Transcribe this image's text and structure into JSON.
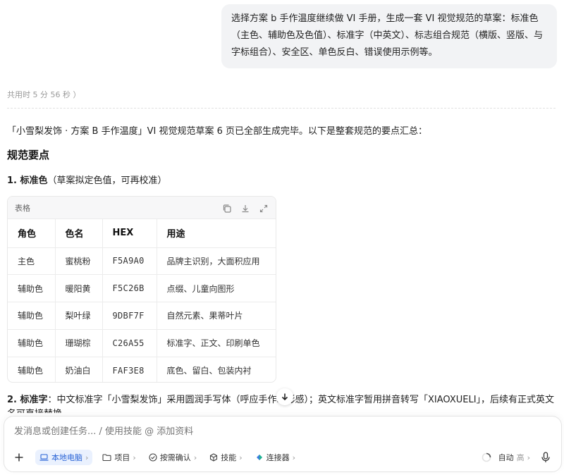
{
  "user_message": {
    "text": "选择方案 b 手作温度继续做 VI 手册，生成一套 VI 视觉规范的草案：标准色（主色、辅助色及色值）、标准字（中英文）、标志组合规范（横版、竖版、与字标组合）、安全区、单色反白、错误使用示例等。"
  },
  "elapsed": "共用时 5 分 56 秒 ）",
  "reply": {
    "intro": "「小雪梨发饰 · 方案 B 手作温度」VI 视觉规范草案 6 页已全部生成完毕。以下是整套规范的要点汇总：",
    "section_title": "规范要点",
    "color_heading_bold": "1. 标准色",
    "color_heading_note": "（草案拟定色值，可再校准）",
    "table": {
      "label": "表格",
      "headers": [
        "角色",
        "色名",
        "HEX",
        "用途"
      ],
      "rows": [
        [
          "主色",
          "蜜桃粉",
          "F5A9A0",
          "品牌主识别，大面积应用"
        ],
        [
          "辅助色",
          "暖阳黄",
          "F5C26B",
          "点缀、儿童向图形"
        ],
        [
          "辅助色",
          "梨叶绿",
          "9DBF7F",
          "自然元素、果蒂叶片"
        ],
        [
          "辅助色",
          "珊瑚棕",
          "C26A55",
          "标准字、正文、印刷单色"
        ],
        [
          "辅助色",
          "奶油白",
          "FAF3E8",
          "底色、留白、包装内衬"
        ]
      ]
    },
    "font_heading_bold": "2. 标准字",
    "font_text": "：中文标准字「小雪梨发饰」采用圆润手写体（呼应手作水彩感）；英文标准字暂用拼音转写「XIAOXUELI」，后续有正式英文名可直接替换。"
  },
  "composer": {
    "placeholder": "发消息或创建任务... / 使用技能 @ 添加资料",
    "chips": [
      {
        "label": "本地电脑",
        "icon": "laptop-icon"
      },
      {
        "label": "项目",
        "icon": "folder-icon"
      },
      {
        "label": "按需确认",
        "icon": "check-circle-icon"
      },
      {
        "label": "技能",
        "icon": "cube-icon"
      },
      {
        "label": "连接器",
        "icon": "connector-icon"
      }
    ],
    "auto_label": "自动",
    "auto_sub": "高"
  },
  "colors": {
    "accent": "#2a64d6",
    "bubble_bg": "#f2f3f5"
  }
}
